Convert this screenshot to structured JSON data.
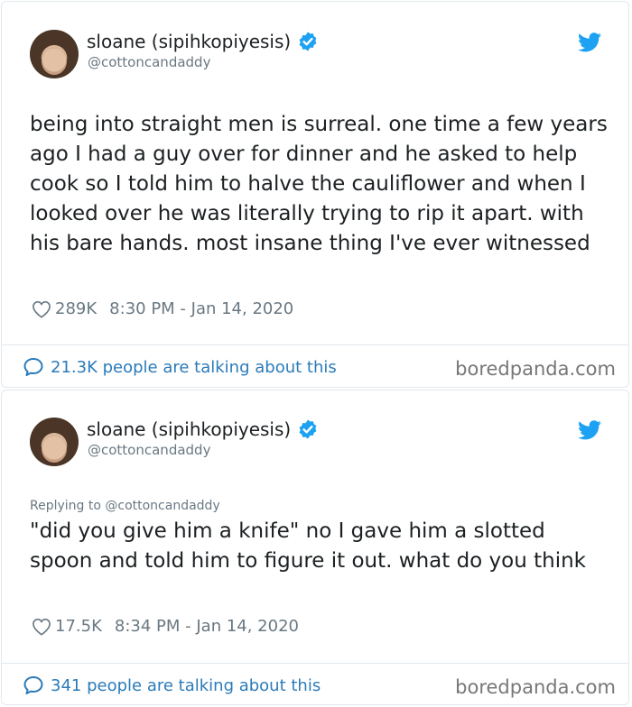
{
  "tweets": [
    {
      "author_name": "sloane (sipihkopiyesis)",
      "handle": "@cottoncandaddy",
      "replying_to": "",
      "text": "being into straight men is surreal. one time a few years ago I had a guy over for dinner and he asked to help cook so I told him to halve the cauliflower and when I looked over he was literally trying to rip it apart. with his bare hands. most insane thing I've ever witnessed",
      "likes": "289K",
      "timestamp": "8:30 PM - Jan 14, 2020",
      "talking": "21.3K people are talking about this",
      "watermark": "boredpanda.com"
    },
    {
      "author_name": "sloane (sipihkopiyesis)",
      "handle": "@cottoncandaddy",
      "replying_to": "Replying to @cottoncandaddy",
      "text": "\"did you give him a knife\" no I gave him a slotted spoon and told him to figure it out. what do you think",
      "likes": "17.5K",
      "timestamp": "8:34 PM - Jan 14, 2020",
      "talking": "341 people are talking about this",
      "watermark": "boredpanda.com"
    }
  ],
  "icons": {
    "verified": "verified-badge-icon",
    "twitter": "twitter-bird-icon",
    "like": "heart-icon",
    "talking": "speech-bubble-icon"
  },
  "colors": {
    "twitter_blue": "#1da1f2",
    "link_blue": "#2b7bb9",
    "muted": "#697882"
  }
}
